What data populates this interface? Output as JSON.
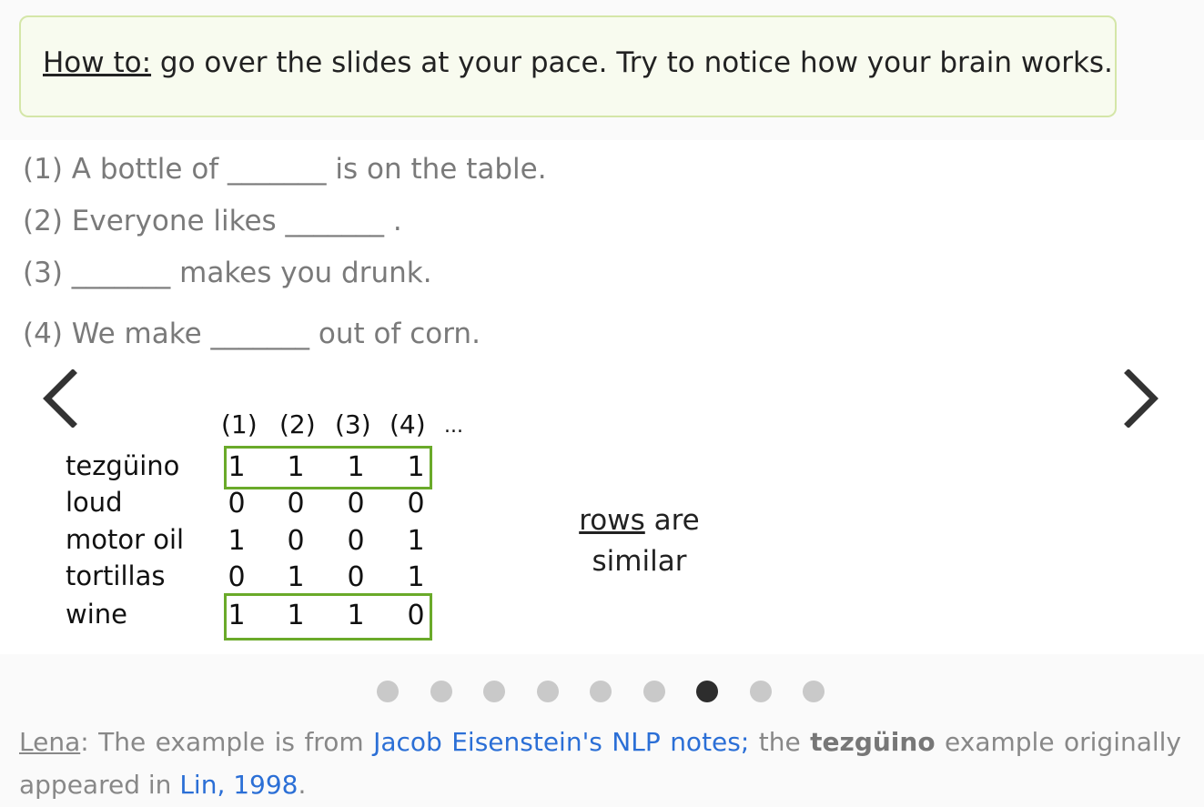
{
  "howto": {
    "label": "How to:",
    "text": " go over the slides at your pace. Try to notice how your brain works."
  },
  "slide": {
    "sentences": [
      "(1) A bottle of _______ is on the table.",
      "(2) Everyone likes _______ .",
      "(3) _______ makes you drunk.",
      "(4) We make _______ out of corn."
    ],
    "table": {
      "columns": [
        "(1)",
        "(2)",
        "(3)",
        "(4)",
        "..."
      ],
      "rows": [
        {
          "label": "tezgüino",
          "values": [
            "1",
            "1",
            "1",
            "1"
          ]
        },
        {
          "label": "loud",
          "values": [
            "0",
            "0",
            "0",
            "0"
          ]
        },
        {
          "label": "motor oil",
          "values": [
            "1",
            "0",
            "0",
            "1"
          ]
        },
        {
          "label": "tortillas",
          "values": [
            "0",
            "1",
            "0",
            "1"
          ]
        },
        {
          "label": "wine",
          "values": [
            "1",
            "1",
            "1",
            "0"
          ]
        }
      ],
      "highlight_color": "#6aaa2a"
    },
    "note": {
      "underlined": "rows",
      "rest_line1": " are",
      "line2": "similar"
    }
  },
  "navigation": {
    "prev_icon": "chevron-left-icon",
    "next_icon": "chevron-right-icon",
    "total_slides": 9,
    "current_slide": 7
  },
  "footer": {
    "author": "Lena",
    "text1": ": The example is from ",
    "link1": "Jacob Eisenstein's NLP notes;",
    "text2": " the ",
    "bold": "tezgüino",
    "text3": " example originally appeared in ",
    "link2": "Lin, 1998",
    "text4": "."
  },
  "colors": {
    "accent_link": "#2b6fd6",
    "howto_border": "#d4e6a8",
    "active_dot": "#2d2d2d",
    "inactive_dot": "#c9c9c9"
  }
}
